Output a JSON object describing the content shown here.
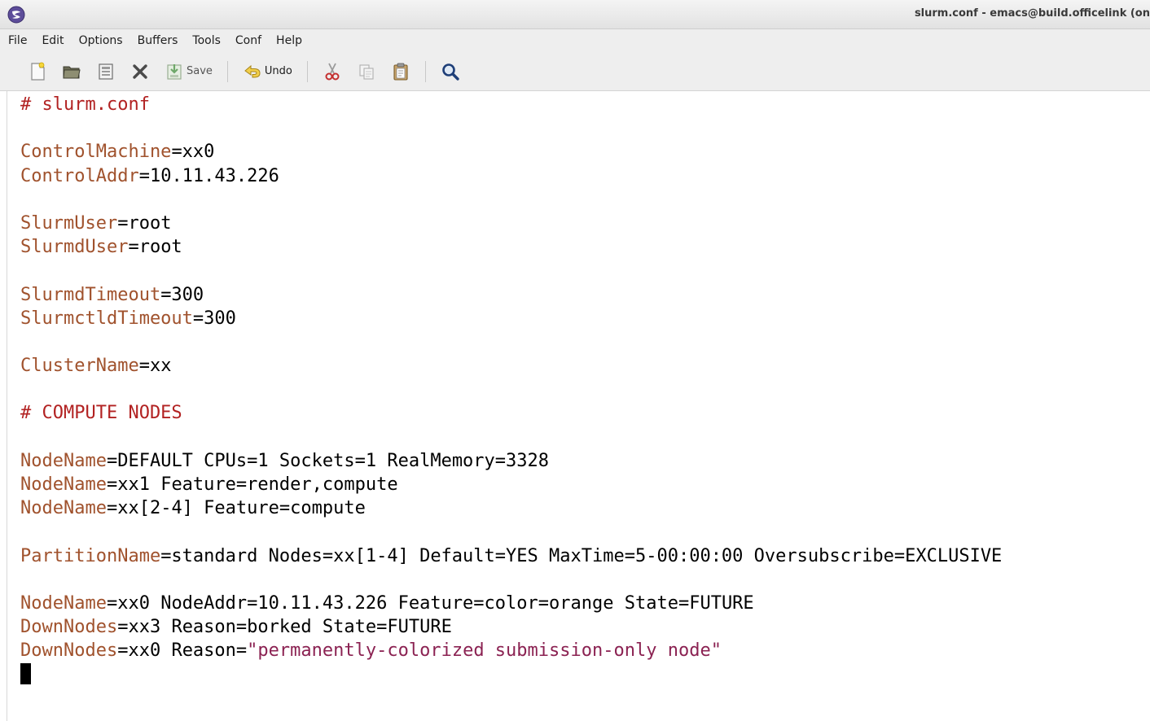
{
  "window": {
    "title": "slurm.conf - emacs@build.officelink (on"
  },
  "menu": [
    "File",
    "Edit",
    "Options",
    "Buffers",
    "Tools",
    "Conf",
    "Help"
  ],
  "toolbar": {
    "save_label": "Save",
    "undo_label": "Undo"
  },
  "editor": {
    "lines": [
      {
        "type": "comment",
        "text": "# slurm.conf"
      },
      {
        "type": "blank"
      },
      {
        "type": "kv",
        "key": "ControlMachine",
        "value": "=xx0"
      },
      {
        "type": "kv",
        "key": "ControlAddr",
        "value": "=10.11.43.226"
      },
      {
        "type": "blank"
      },
      {
        "type": "kv",
        "key": "SlurmUser",
        "value": "=root"
      },
      {
        "type": "kv",
        "key": "SlurmdUser",
        "value": "=root"
      },
      {
        "type": "blank"
      },
      {
        "type": "kv",
        "key": "SlurmdTimeout",
        "value": "=300"
      },
      {
        "type": "kv",
        "key": "SlurmctldTimeout",
        "value": "=300"
      },
      {
        "type": "blank"
      },
      {
        "type": "kv",
        "key": "ClusterName",
        "value": "=xx"
      },
      {
        "type": "blank"
      },
      {
        "type": "comment",
        "text": "# COMPUTE NODES"
      },
      {
        "type": "blank"
      },
      {
        "type": "kv",
        "key": "NodeName",
        "value": "=DEFAULT CPUs=1 Sockets=1 RealMemory=3328"
      },
      {
        "type": "kv",
        "key": "NodeName",
        "value": "=xx1 Feature=render,compute"
      },
      {
        "type": "kv",
        "key": "NodeName",
        "value": "=xx[2-4] Feature=compute"
      },
      {
        "type": "blank"
      },
      {
        "type": "kv",
        "key": "PartitionName",
        "value": "=standard Nodes=xx[1-4] Default=YES MaxTime=5-00:00:00 Oversubscribe=EXCLUSIVE"
      },
      {
        "type": "blank"
      },
      {
        "type": "kv",
        "key": "NodeName",
        "value": "=xx0 NodeAddr=10.11.43.226 Feature=color=orange State=FUTURE"
      },
      {
        "type": "kv",
        "key": "DownNodes",
        "value": "=xx3 Reason=borked State=FUTURE"
      },
      {
        "type": "kvs",
        "key": "DownNodes",
        "value": "=xx0 Reason=",
        "string": "\"permanently-colorized submission-only node\""
      },
      {
        "type": "cursor"
      }
    ]
  },
  "colors": {
    "comment": "#b22222",
    "key": "#a0522d",
    "string": "#8b2252",
    "text": "#000000"
  },
  "icons": [
    "emacs-icon",
    "new-file-icon",
    "open-folder-icon",
    "save-doc-icon",
    "close-icon",
    "save-icon",
    "undo-icon",
    "cut-icon",
    "copy-icon",
    "paste-icon",
    "search-icon"
  ]
}
